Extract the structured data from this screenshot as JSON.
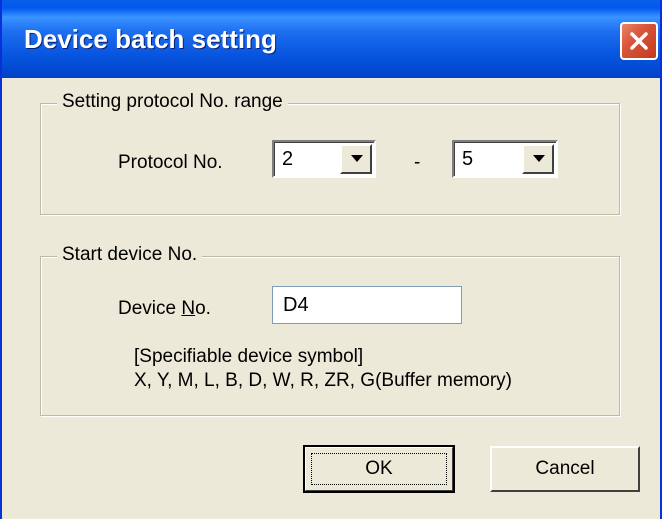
{
  "window": {
    "title": "Device batch setting",
    "close_icon": "close-icon"
  },
  "protocol_group": {
    "label": "Setting protocol No. range",
    "field_label": "Protocol No.",
    "separator": "-",
    "from": {
      "value": "2",
      "icon": "chevron-down-icon"
    },
    "to": {
      "value": "5",
      "icon": "chevron-down-icon"
    }
  },
  "device_group": {
    "label": "Start device No.",
    "field_label_pre": "Device ",
    "field_label_accel": "N",
    "field_label_post": "o.",
    "device_no": "D4",
    "hint_line1": "[Specifiable device symbol]",
    "hint_line2": "X, Y, M, L, B, D, W, R, ZR, G(Buffer memory)"
  },
  "buttons": {
    "ok_label": "OK",
    "cancel_label": "Cancel"
  },
  "colors": {
    "titlebar": "#0058ee",
    "dialog_bg": "#ece9d8",
    "close_button": "#d9543a"
  }
}
